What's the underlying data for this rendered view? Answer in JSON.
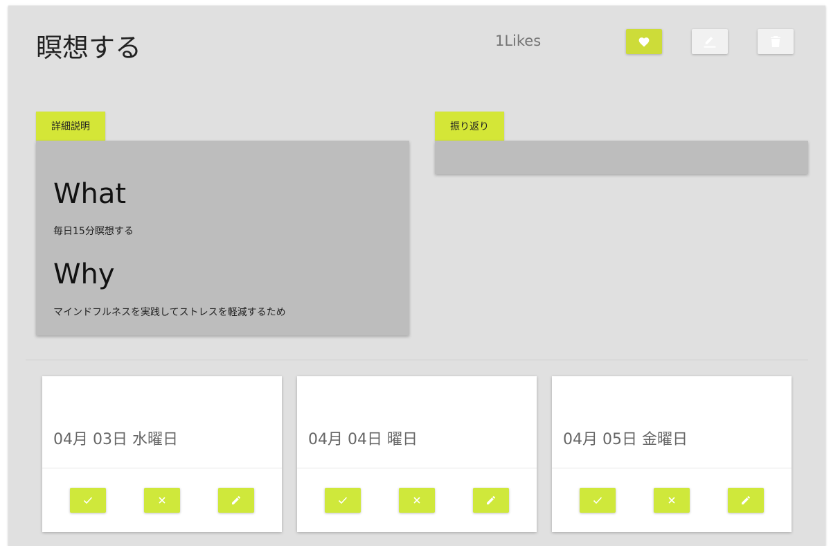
{
  "header": {
    "title": "瞑想する",
    "likes": "1Likes",
    "buttons": [
      {
        "icon": "heart-icon"
      },
      {
        "icon": "pencil-underline-icon"
      },
      {
        "icon": "trash-icon"
      }
    ]
  },
  "detail": {
    "tab_label": "詳細説明",
    "what_heading": "What",
    "what_text": "毎日15分瞑想する",
    "why_heading": "Why",
    "why_text": "マインドフルネスを実践してストレスを軽減するため"
  },
  "review": {
    "tab_label": "振り返り"
  },
  "days": [
    {
      "date": "04月 03日 水曜日"
    },
    {
      "date": "04月 04日 曜日"
    },
    {
      "date": "04月 05日 金曜日"
    }
  ],
  "day_actions": [
    "check-icon",
    "close-icon",
    "pencil-icon"
  ],
  "colors": {
    "accent": "#cddc39",
    "panel_bg": "#e0e0e0",
    "card_bg": "#bdbdbd"
  }
}
